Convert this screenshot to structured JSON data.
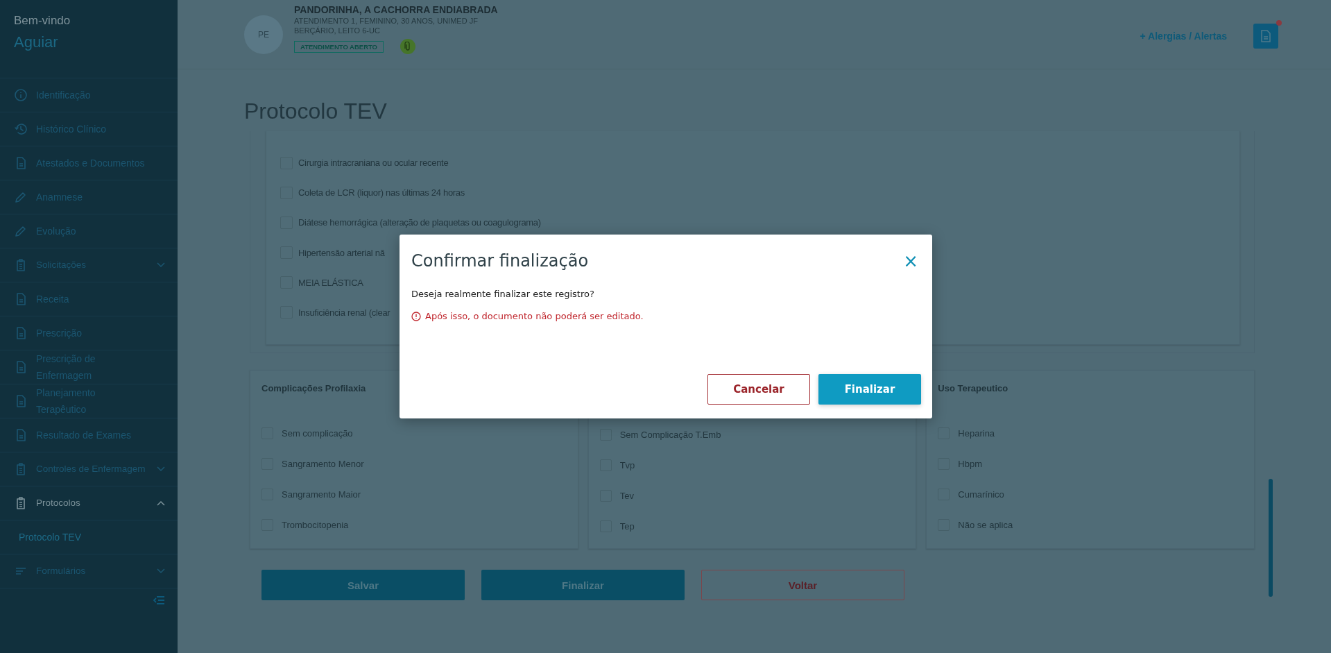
{
  "sidebar": {
    "greeting": "Bem-vindo",
    "user": "Aguiar",
    "items": [
      {
        "label": "Identificação",
        "kind": "link",
        "selected": false
      },
      {
        "label": "Histórico Clínico",
        "kind": "link",
        "selected": false
      },
      {
        "label": "Atestados e Documentos",
        "kind": "link",
        "selected": false
      },
      {
        "label": "Anamnese",
        "kind": "link",
        "selected": false
      },
      {
        "label": "Evolução",
        "kind": "link",
        "selected": false
      },
      {
        "label": "Solicitações",
        "kind": "submenu",
        "selected": false,
        "expanded": false
      },
      {
        "label": "Receita",
        "kind": "link",
        "selected": false
      },
      {
        "label": "Prescrição",
        "kind": "link",
        "selected": false
      },
      {
        "label": "Prescrição de Enfermagem",
        "kind": "link",
        "selected": false
      },
      {
        "label": "Planejamento Terapêutico",
        "kind": "link",
        "selected": false
      },
      {
        "label": "Resultado de Exames",
        "kind": "link",
        "selected": false
      },
      {
        "label": "Controles de Enfermagem",
        "kind": "submenu",
        "selected": false,
        "expanded": false
      },
      {
        "label": "Protocolos",
        "kind": "submenu",
        "selected": true,
        "expanded": true,
        "children": [
          {
            "label": "Protocolo TEV",
            "selected": true
          }
        ]
      },
      {
        "label": "Formulários",
        "kind": "submenu",
        "selected": false,
        "expanded": false
      }
    ]
  },
  "patient": {
    "initials": "PE",
    "name": "PANDORINHA, A CACHORRA ENDIABRADA",
    "details": "ATENDIMENTO 1, FEMININO, 30 ANOS, UNIMED JF",
    "location": "BERÇÁRIO, LEITO 6-UC",
    "status": "ATENDIMENTO ABERTO",
    "alerts_link": "+ Alergias / Alertas",
    "notification": true
  },
  "page_title": "Protocolo TEV",
  "contraindications": [
    {
      "label": "Cirurgia intracraniana ou ocular recente",
      "checked": false
    },
    {
      "label": "Coleta de LCR (liquor) nas últimas 24 horas",
      "checked": false
    },
    {
      "label": "Diátese hemorrágica (alteração de plaquetas ou coagulograma)",
      "checked": false
    },
    {
      "label": "Hipertensão arterial nã",
      "checked": false
    },
    {
      "label": "MEIA ELÁSTICA",
      "checked": false
    },
    {
      "label": "Insuficiência renal (clear",
      "checked": false
    }
  ],
  "sections": [
    {
      "title": "Complicações Profilaxia",
      "options": [
        {
          "label": "Sem complicação",
          "checked": false
        },
        {
          "label": "Sangramento Menor",
          "checked": false
        },
        {
          "label": "Sangramento Maior",
          "checked": false
        },
        {
          "label": "Trombocitopenia",
          "checked": false
        }
      ]
    },
    {
      "options": [
        {
          "label": "Sem Complicação T.Emb",
          "checked": false
        },
        {
          "label": "Tvp",
          "checked": false
        },
        {
          "label": "Tev",
          "checked": false
        },
        {
          "label": "Tep",
          "checked": false
        }
      ]
    },
    {
      "title": "Uso Terapeutico",
      "options": [
        {
          "label": "Heparina",
          "checked": false
        },
        {
          "label": "Hbpm",
          "checked": false
        },
        {
          "label": "Cumarínico",
          "checked": false
        },
        {
          "label": "Não se aplica",
          "checked": false
        }
      ]
    }
  ],
  "actions": [
    {
      "label": "Salvar",
      "kind": "primary"
    },
    {
      "label": "Finalizar",
      "kind": "primary"
    },
    {
      "label": "Voltar",
      "kind": "outline"
    }
  ],
  "dialog": {
    "title": "Confirmar finalização",
    "close": "×",
    "message": "Deseja realmente finalizar este registro?",
    "warning": "Após isso, o documento não poderá ser editado.",
    "buttons": [
      {
        "label": "Cancelar",
        "kind": "outline"
      },
      {
        "label": "Finalizar",
        "kind": "primary"
      }
    ]
  }
}
